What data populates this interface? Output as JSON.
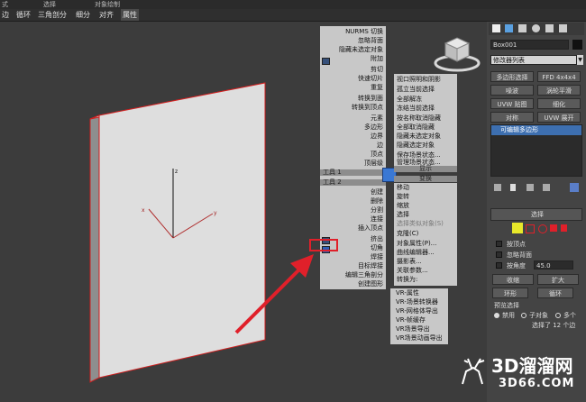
{
  "top_menu": [
    "式",
    "选择",
    "对象绘制"
  ],
  "ribbon_tabs": [
    "边",
    "循环",
    "三角剖分",
    "细分",
    "对齐",
    "属性"
  ],
  "active_tab_index": 5,
  "quad_menu_left": {
    "top": [
      "NURMS 切换",
      "忽略背面",
      "隐藏未选定对象",
      "附加",
      "剪切",
      "快速切片",
      "重复",
      "转换到面",
      "转换到顶点",
      "元素",
      "多边形",
      "边界",
      "边",
      "顶点",
      "顶层级"
    ],
    "tools_header_1": "工具 1",
    "tools_header_2": "工具 2",
    "bottom": [
      "创建",
      "删除",
      "分割",
      "连接",
      "插入顶点",
      "挤出",
      "切角",
      "焊接",
      "目标焊接",
      "编辑三角剖分",
      "创建图形"
    ]
  },
  "quad_menu_right": {
    "top": [
      "视口照明和阴影",
      "孤立当前选择",
      "全部解冻",
      "冻结当前选择",
      "按名称取消隐藏",
      "全部取消隐藏",
      "隐藏未选定对象",
      "隐藏选定对象",
      "保存场景状态...",
      "管理场景状态..."
    ],
    "display_header": "显示",
    "transform_header": "变换",
    "bottom": [
      "移动",
      "旋转",
      "缩放",
      "选择",
      "选择类似对象(S)",
      "克隆(C)",
      "对象属性(P)...",
      "曲线编辑器...",
      "摄影表...",
      "关联参数...",
      "转换为:"
    ],
    "vray": [
      "VR-属性",
      "VR-场景转换器",
      "VR-网格体导出",
      "VR-帧缓存",
      "VR场景导出",
      "VR场景动画导出"
    ]
  },
  "command_panel": {
    "object_name": "Box001",
    "modifier_list": "修改器列表",
    "buttons": [
      "多边形选择",
      "FFD 4x4x4",
      "噪波",
      "涡轮平滑",
      "UVW 贴图",
      "细化",
      "对称",
      "UVW 展开"
    ],
    "stack_item": "可编辑多边形",
    "rollout_title": "选择",
    "checkbox_vertex": "按顶点",
    "checkbox_backface": "忽略背面",
    "checkbox_angle": "按角度",
    "angle_value": "45.0",
    "shrink": "收缩",
    "grow": "扩大",
    "ring": "环形",
    "loop": "循环",
    "preview_title": "预览选择",
    "preview_options": [
      "禁用",
      "子对象",
      "多个"
    ],
    "status": "选择了 12 个边"
  },
  "axis_labels": {
    "z": "z",
    "x": "x",
    "y": "y"
  },
  "watermark": {
    "brand": "3D溜溜网",
    "url": "3D66.COM"
  },
  "colors": {
    "accent_red": "#e0202a",
    "menu_bg": "#c8c8c8",
    "highlight_blue": "#3a78d4"
  }
}
